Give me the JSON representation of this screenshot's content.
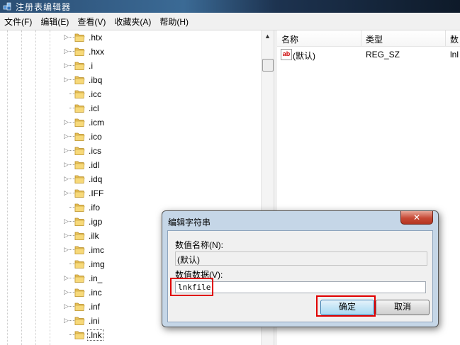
{
  "window": {
    "title": "注册表编辑器"
  },
  "menu": [
    "文件(F)",
    "编辑(E)",
    "查看(V)",
    "收藏夹(A)",
    "帮助(H)"
  ],
  "tree": {
    "items": [
      {
        "name": ".htx",
        "expandable": true
      },
      {
        "name": ".hxx",
        "expandable": true
      },
      {
        "name": ".i",
        "expandable": true
      },
      {
        "name": ".ibq",
        "expandable": true
      },
      {
        "name": ".icc",
        "expandable": false
      },
      {
        "name": ".icl",
        "expandable": false
      },
      {
        "name": ".icm",
        "expandable": true
      },
      {
        "name": ".ico",
        "expandable": true
      },
      {
        "name": ".ics",
        "expandable": true
      },
      {
        "name": ".idl",
        "expandable": true
      },
      {
        "name": ".idq",
        "expandable": true
      },
      {
        "name": ".IFF",
        "expandable": true
      },
      {
        "name": ".ifo",
        "expandable": false
      },
      {
        "name": ".igp",
        "expandable": true
      },
      {
        "name": ".ilk",
        "expandable": true
      },
      {
        "name": ".imc",
        "expandable": true
      },
      {
        "name": ".img",
        "expandable": false
      },
      {
        "name": ".in_",
        "expandable": true
      },
      {
        "name": ".inc",
        "expandable": true
      },
      {
        "name": ".inf",
        "expandable": true
      },
      {
        "name": ".ini",
        "expandable": true
      },
      {
        "name": ".lnk",
        "expandable": false,
        "selected": true
      }
    ]
  },
  "listview": {
    "columns": [
      "名称",
      "类型",
      "数"
    ],
    "rows": [
      {
        "name": "(默认)",
        "type": "REG_SZ",
        "data": "lnl"
      }
    ]
  },
  "dialog": {
    "title": "编辑字符串",
    "close_glyph": "✕",
    "name_label": "数值名称(N):",
    "name_value": "(默认)",
    "data_label": "数值数据(V):",
    "data_value": "lnkfile",
    "ok_label": "确定",
    "cancel_label": "取消"
  },
  "colors": {
    "highlight_box": "#e00000",
    "dialog_frame": "#c5d6e7"
  }
}
